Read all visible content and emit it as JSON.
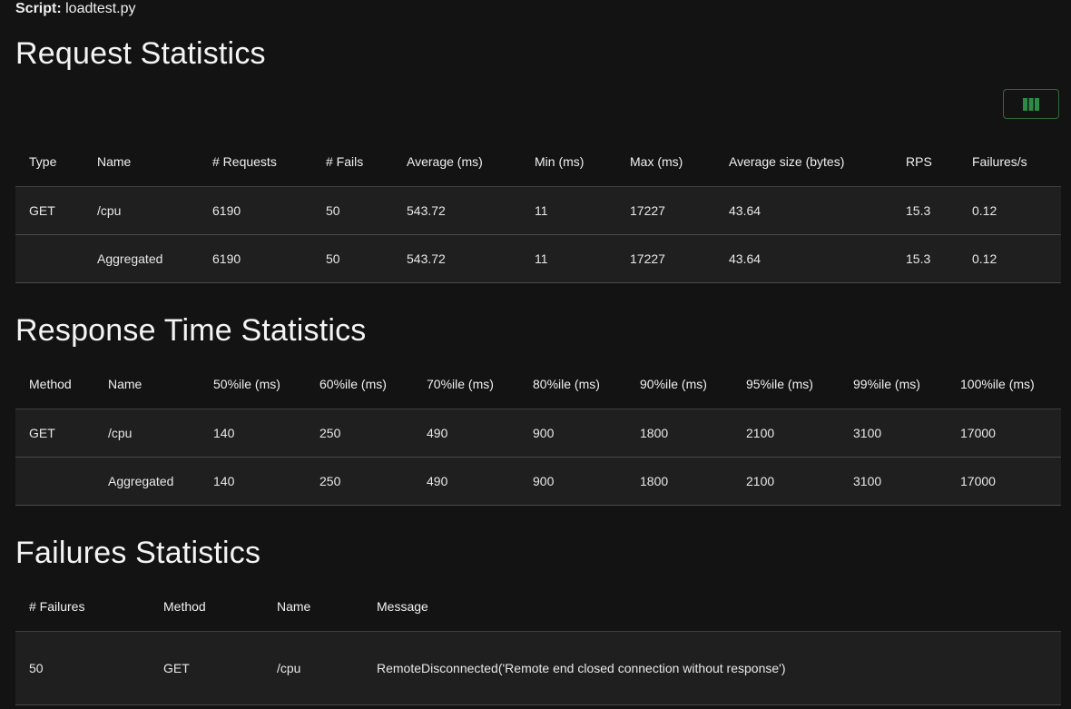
{
  "script": {
    "label": "Script:",
    "value": "loadtest.py"
  },
  "request": {
    "title": "Request Statistics",
    "headers": [
      "Type",
      "Name",
      "# Requests",
      "# Fails",
      "Average (ms)",
      "Min (ms)",
      "Max (ms)",
      "Average size (bytes)",
      "RPS",
      "Failures/s"
    ],
    "rows": [
      [
        "GET",
        "/cpu",
        "6190",
        "50",
        "543.72",
        "11",
        "17227",
        "43.64",
        "15.3",
        "0.12"
      ],
      [
        "",
        "Aggregated",
        "6190",
        "50",
        "543.72",
        "11",
        "17227",
        "43.64",
        "15.3",
        "0.12"
      ]
    ]
  },
  "response": {
    "title": "Response Time Statistics",
    "headers": [
      "Method",
      "Name",
      "50%ile (ms)",
      "60%ile (ms)",
      "70%ile (ms)",
      "80%ile (ms)",
      "90%ile (ms)",
      "95%ile (ms)",
      "99%ile (ms)",
      "100%ile (ms)"
    ],
    "rows": [
      [
        "GET",
        "/cpu",
        "140",
        "250",
        "490",
        "900",
        "1800",
        "2100",
        "3100",
        "17000"
      ],
      [
        "",
        "Aggregated",
        "140",
        "250",
        "490",
        "900",
        "1800",
        "2100",
        "3100",
        "17000"
      ]
    ]
  },
  "failures": {
    "title": "Failures Statistics",
    "headers": [
      "# Failures",
      "Method",
      "Name",
      "Message"
    ],
    "rows": [
      [
        "50",
        "GET",
        "/cpu",
        "RemoteDisconnected('Remote end closed connection without response')"
      ]
    ]
  },
  "icons": {
    "column_selector": "columns-icon"
  },
  "colors": {
    "background": "#131313",
    "row": "#1f1f1f",
    "accent": "#2e8b45"
  }
}
